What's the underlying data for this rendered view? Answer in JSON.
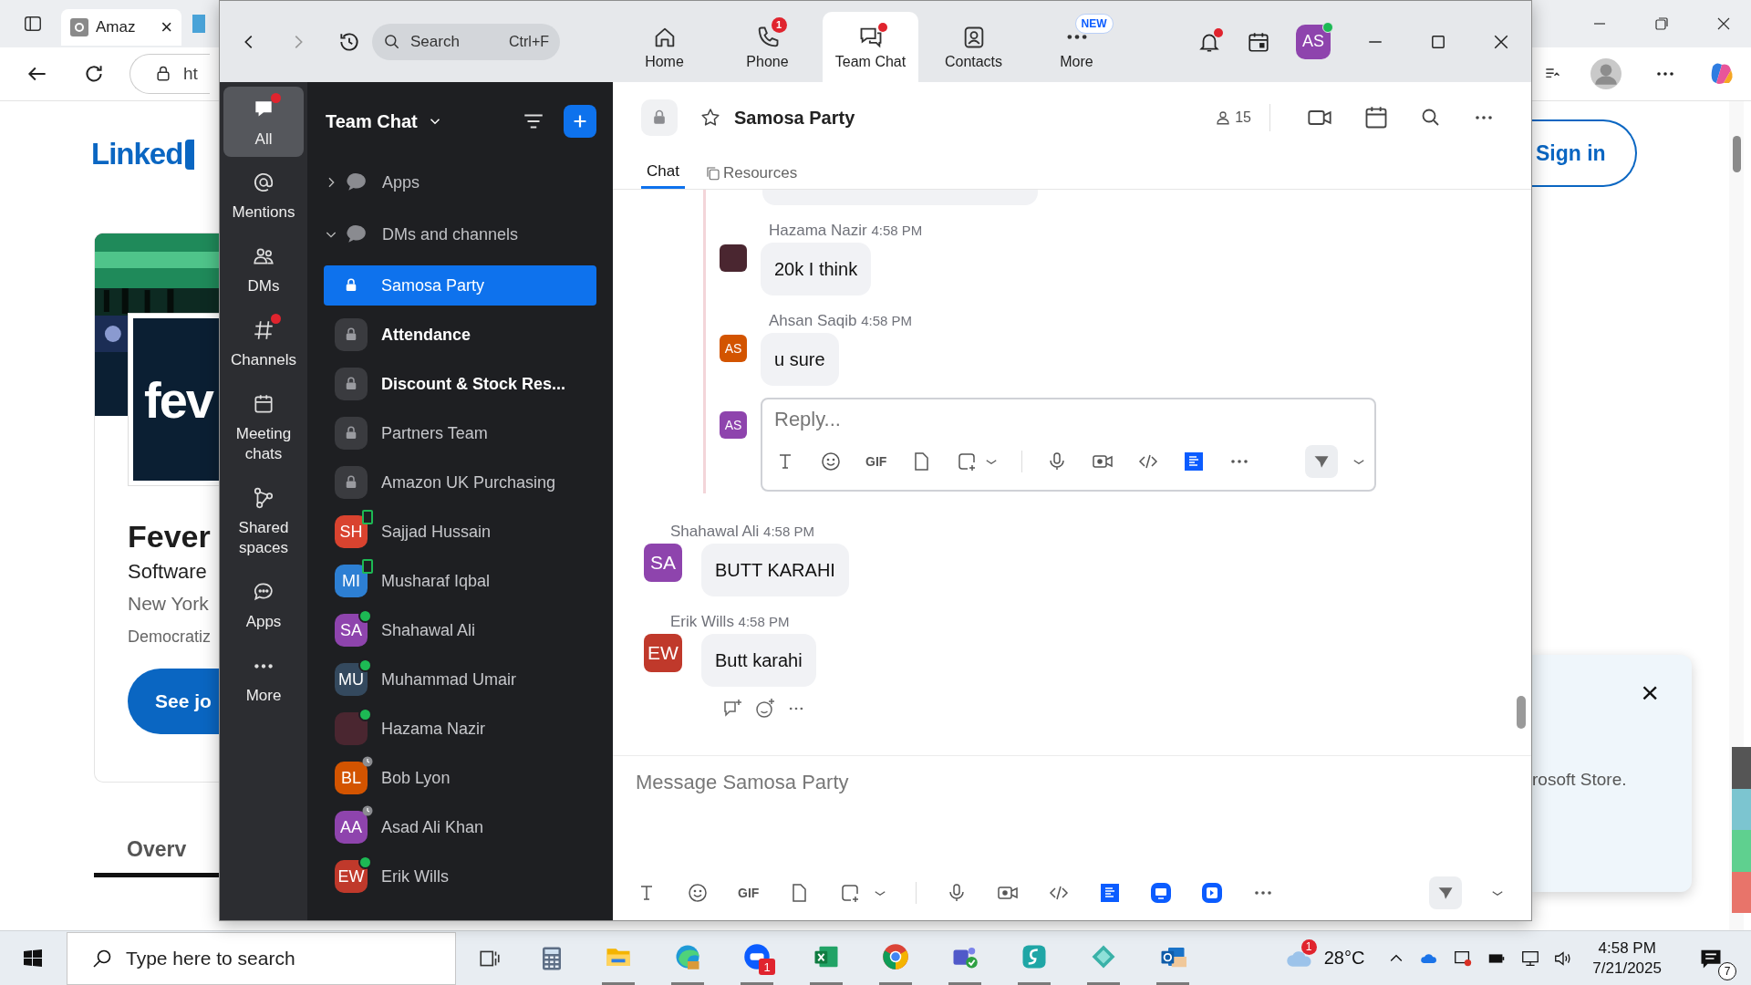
{
  "browser": {
    "tab": {
      "label": "Amaz",
      "close": "×"
    },
    "address": "ht",
    "page": {
      "logo": "Linked",
      "card_logo": "fev",
      "company": "Fever",
      "industry": "Software",
      "location": "New York",
      "tagline": "Democratiz",
      "cta": "See jo",
      "tab": "Overv",
      "sign_in": "Sign in",
      "toast_close": "×",
      "toast_text": "rosoft Store."
    }
  },
  "zoom": {
    "search": {
      "placeholder": "Search",
      "shortcut": "Ctrl+F"
    },
    "nav": [
      {
        "label": "Home",
        "selected": false,
        "dot": false
      },
      {
        "label": "Phone",
        "selected": false,
        "dot": false,
        "badge": "1"
      },
      {
        "label": "Team Chat",
        "selected": true,
        "dot": true
      },
      {
        "label": "Contacts",
        "selected": false,
        "dot": false
      },
      {
        "label": "More",
        "selected": false,
        "dot": false,
        "tag": "NEW"
      }
    ],
    "notifications_dot": true,
    "user": {
      "initials": "AS",
      "color": "#8e44ad",
      "online": true
    },
    "rail": [
      {
        "label": "All",
        "selected": true,
        "dot": true
      },
      {
        "label": "Mentions",
        "selected": false,
        "dot": false
      },
      {
        "label": "DMs",
        "selected": false,
        "dot": false
      },
      {
        "label": "Channels",
        "selected": false,
        "dot": true
      },
      {
        "label": "Meeting chats",
        "selected": false,
        "dot": false
      },
      {
        "label": "Shared spaces",
        "selected": false,
        "dot": false
      },
      {
        "label": "Apps",
        "selected": false,
        "dot": false
      },
      {
        "label": "More",
        "selected": false,
        "dot": false
      }
    ],
    "list_title": "Team Chat",
    "sections": [
      {
        "label": "Apps",
        "expanded": false
      },
      {
        "label": "DMs and channels",
        "expanded": true
      }
    ],
    "conversations": [
      {
        "name": "Samosa Party",
        "kind": "channel",
        "selected": true,
        "unread": false
      },
      {
        "name": "Attendance",
        "kind": "channel",
        "selected": false,
        "unread": true
      },
      {
        "name": "Discount & Stock Res...",
        "kind": "channel",
        "selected": false,
        "unread": true
      },
      {
        "name": "Partners Team",
        "kind": "channel",
        "selected": false,
        "unread": false
      },
      {
        "name": "Amazon UK Purchasing",
        "kind": "channel",
        "selected": false,
        "unread": false
      },
      {
        "name": "Sajjad Hussain",
        "kind": "person",
        "initials": "SH",
        "color": "#d9432f",
        "online": false,
        "mobile": true,
        "away": false,
        "selected": false,
        "unread": false
      },
      {
        "name": "Musharaf Iqbal",
        "kind": "person",
        "initials": "MI",
        "color": "#2d7fd3",
        "online": false,
        "mobile": true,
        "away": false,
        "selected": false,
        "unread": false
      },
      {
        "name": "Shahawal Ali",
        "kind": "person",
        "initials": "SA",
        "color": "#8e44ad",
        "online": true,
        "mobile": false,
        "away": false,
        "selected": false,
        "unread": false
      },
      {
        "name": "Muhammad Umair",
        "kind": "person",
        "initials": "MU",
        "color": "#34495e",
        "online": true,
        "mobile": false,
        "away": false,
        "selected": false,
        "unread": false
      },
      {
        "name": "Hazama Nazir",
        "kind": "person",
        "color": "#4a2630",
        "online": true,
        "mobile": false,
        "away": false,
        "selected": false,
        "unread": false
      },
      {
        "name": "Bob Lyon",
        "kind": "person",
        "initials": "BL",
        "color": "#d35400",
        "online": false,
        "mobile": false,
        "away": true,
        "selected": false,
        "unread": false
      },
      {
        "name": "Asad Ali Khan",
        "kind": "person",
        "initials": "AA",
        "color": "#8e44ad",
        "online": false,
        "mobile": false,
        "away": true,
        "selected": false,
        "unread": false
      },
      {
        "name": "Erik Wills",
        "kind": "person",
        "initials": "EW",
        "color": "#c0392b",
        "online": true,
        "mobile": false,
        "away": false,
        "selected": false,
        "unread": false
      }
    ],
    "chat": {
      "title": "Samosa Party",
      "starred": false,
      "members": "15",
      "tabs": [
        {
          "label": "Chat",
          "selected": true
        },
        {
          "label": "Resources",
          "selected": false
        }
      ],
      "thread": [
        {
          "author": "Hazama Nazir",
          "time": "4:58 PM",
          "text": "20k I think",
          "color": "#4a2630"
        },
        {
          "author": "Ahsan Saqib",
          "time": "4:58 PM",
          "text": "u sure",
          "initials": "AS",
          "color": "#d35400"
        }
      ],
      "reply": {
        "initials": "AS",
        "color": "#8e44ad",
        "placeholder": "Reply...",
        "gif_label": "GIF"
      },
      "messages": [
        {
          "author": "Shahawal Ali",
          "time": "4:58 PM",
          "text": "BUTT KARAHI",
          "initials": "SA",
          "color": "#8e44ad"
        },
        {
          "author": "Erik Wills",
          "time": "4:58 PM",
          "text": "Butt karahi",
          "initials": "EW",
          "color": "#c0392b"
        }
      ],
      "composer": {
        "placeholder": "Message Samosa Party",
        "gif_label": "GIF"
      }
    }
  },
  "taskbar": {
    "search_placeholder": "Type here to search",
    "zoom_badge": "1",
    "weather_badge": "1",
    "weather": "28°C",
    "time": "4:58 PM",
    "date": "7/21/2025",
    "notifications": "7"
  }
}
